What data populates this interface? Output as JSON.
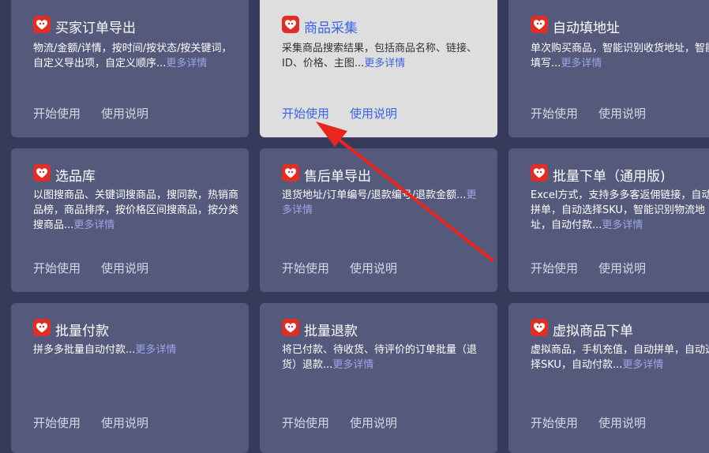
{
  "cards": [
    {
      "title": "买家订单导出",
      "desc": "物流/金额/详情，按时间/按状态/按关键词，自定义导出项，自定义顺序...",
      "more": "更多详情",
      "start": "开始使用",
      "guide": "使用说明"
    },
    {
      "title": "商品采集",
      "desc": "采集商品搜索结果，包括商品名称、链接、ID、价格、主图...",
      "more": "更多详情",
      "start": "开始使用",
      "guide": "使用说明"
    },
    {
      "title": "自动填地址",
      "desc": "单次购买商品，智能识别收货地址，智能填写...",
      "more": "更多详情",
      "start": "开始使用",
      "guide": "使用说明"
    },
    {
      "title": "选品库",
      "desc": "以图搜商品、关键词搜商品，搜同款，热销商品榜，商品排序，按价格区间搜商品，按分类搜商品...",
      "more": "更多详情",
      "start": "开始使用",
      "guide": "使用说明"
    },
    {
      "title": "售后单导出",
      "desc": "退货地址/订单编号/退款编号/退款金额...",
      "more": "更多详情",
      "start": "开始使用",
      "guide": "使用说明"
    },
    {
      "title": "批量下单（通用版)",
      "desc": "Excel方式，支持多多客返佣链接，自动拼单，自动选择SKU，智能识别物流地址，自动付款...",
      "more": "更多详情",
      "start": "开始使用",
      "guide": "使用说明"
    },
    {
      "title": "批量付款",
      "desc": "拼多多批量自动付款...",
      "more": "更多详情",
      "start": "开始使用",
      "guide": "使用说明"
    },
    {
      "title": "批量退款",
      "desc": "将已付款、待收货、待评价的订单批量（退货）退款...",
      "more": "更多详情",
      "start": "开始使用",
      "guide": "使用说明"
    },
    {
      "title": "虚拟商品下单",
      "desc": "虚拟商品，手机充值，自动拼单，自动选择SKU，自动付款...",
      "more": "更多详情",
      "start": "开始使用",
      "guide": "使用说明"
    }
  ],
  "colors": {
    "card": "#55597c",
    "highlight_card": "#dedede",
    "background": "#383a5c",
    "link_blue": "#3d63e6",
    "arrow": "#e8261e",
    "logo": "#e02e24"
  }
}
